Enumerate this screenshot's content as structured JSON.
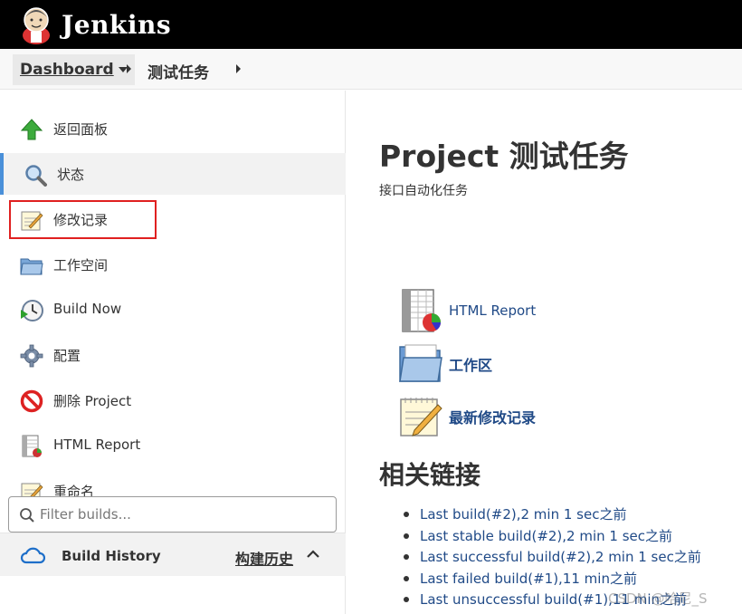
{
  "header": {
    "brand": "Jenkins",
    "logo_icon": "jenkins-butler-icon"
  },
  "breadcrumb": {
    "dashboard": "Dashboard",
    "job": "测试任务"
  },
  "sidebar": {
    "tasks": [
      {
        "label": "返回面板",
        "icon": "up-arrow-icon"
      },
      {
        "label": "状态",
        "icon": "search-icon",
        "active": true
      },
      {
        "label": "修改记录",
        "icon": "notepad-icon"
      },
      {
        "label": "工作空间",
        "icon": "folder-icon"
      },
      {
        "label": "Build Now",
        "icon": "clock-icon"
      },
      {
        "label": "配置",
        "icon": "gear-icon"
      },
      {
        "label": "删除 Project",
        "icon": "no-entry-icon"
      },
      {
        "label": "HTML Report",
        "icon": "report-icon"
      },
      {
        "label": "重命名",
        "icon": "notepad-icon"
      }
    ],
    "build_history": {
      "title": "Build History",
      "trend": "构建历史",
      "filter_placeholder": "Filter builds..."
    }
  },
  "main": {
    "title": "Project 测试任务",
    "description": "接口自动化任务",
    "links": [
      {
        "label": "HTML Report"
      },
      {
        "label": "工作区"
      },
      {
        "label": "最新修改记录"
      }
    ],
    "related_heading": "相关链接",
    "permalinks": [
      "Last build(#2),2 min 1 sec之前",
      "Last stable build(#2),2 min 1 sec之前",
      "Last successful build(#2),2 min 1 sec之前",
      "Last failed build(#1),11 min之前",
      "Last unsuccessful build(#1),11 min之前"
    ]
  },
  "watermark": "CSDN @哈尼_S",
  "colors": {
    "header_bg": "#000000",
    "link": "#204a87",
    "highlight_box": "#e02020",
    "active_bar": "#4a90d9"
  }
}
